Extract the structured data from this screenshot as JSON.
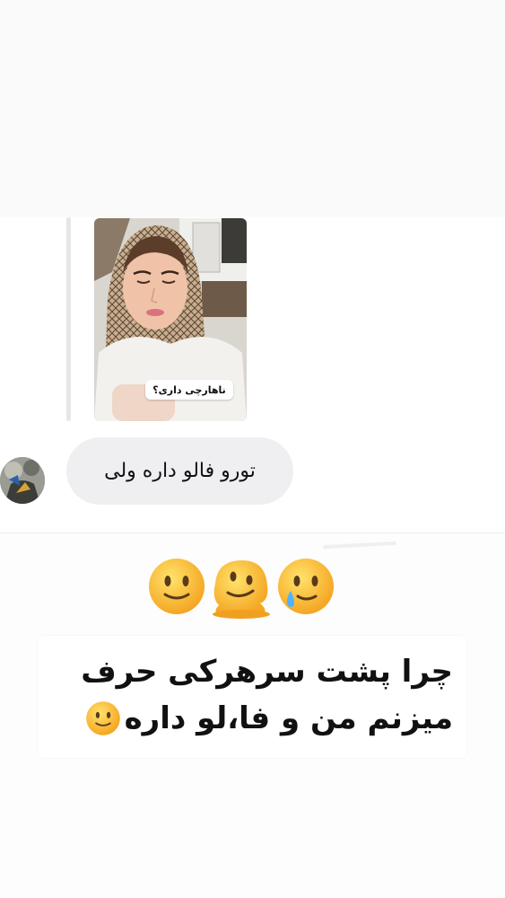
{
  "story_reply": {
    "thumbnail_caption": "ناهارچی داری؟"
  },
  "message": {
    "text": "تورو فالو داره ولی"
  },
  "emojis": [
    "slightly-smiling-face",
    "melting-face",
    "smiling-face-with-tear"
  ],
  "caption": {
    "line1": "چرا پشت سرهرکی حرف",
    "line2": "میزنم من و فا،لو داره"
  },
  "colors": {
    "bubble": "#efeff1",
    "emoji_yellow": "#fbc02d"
  }
}
